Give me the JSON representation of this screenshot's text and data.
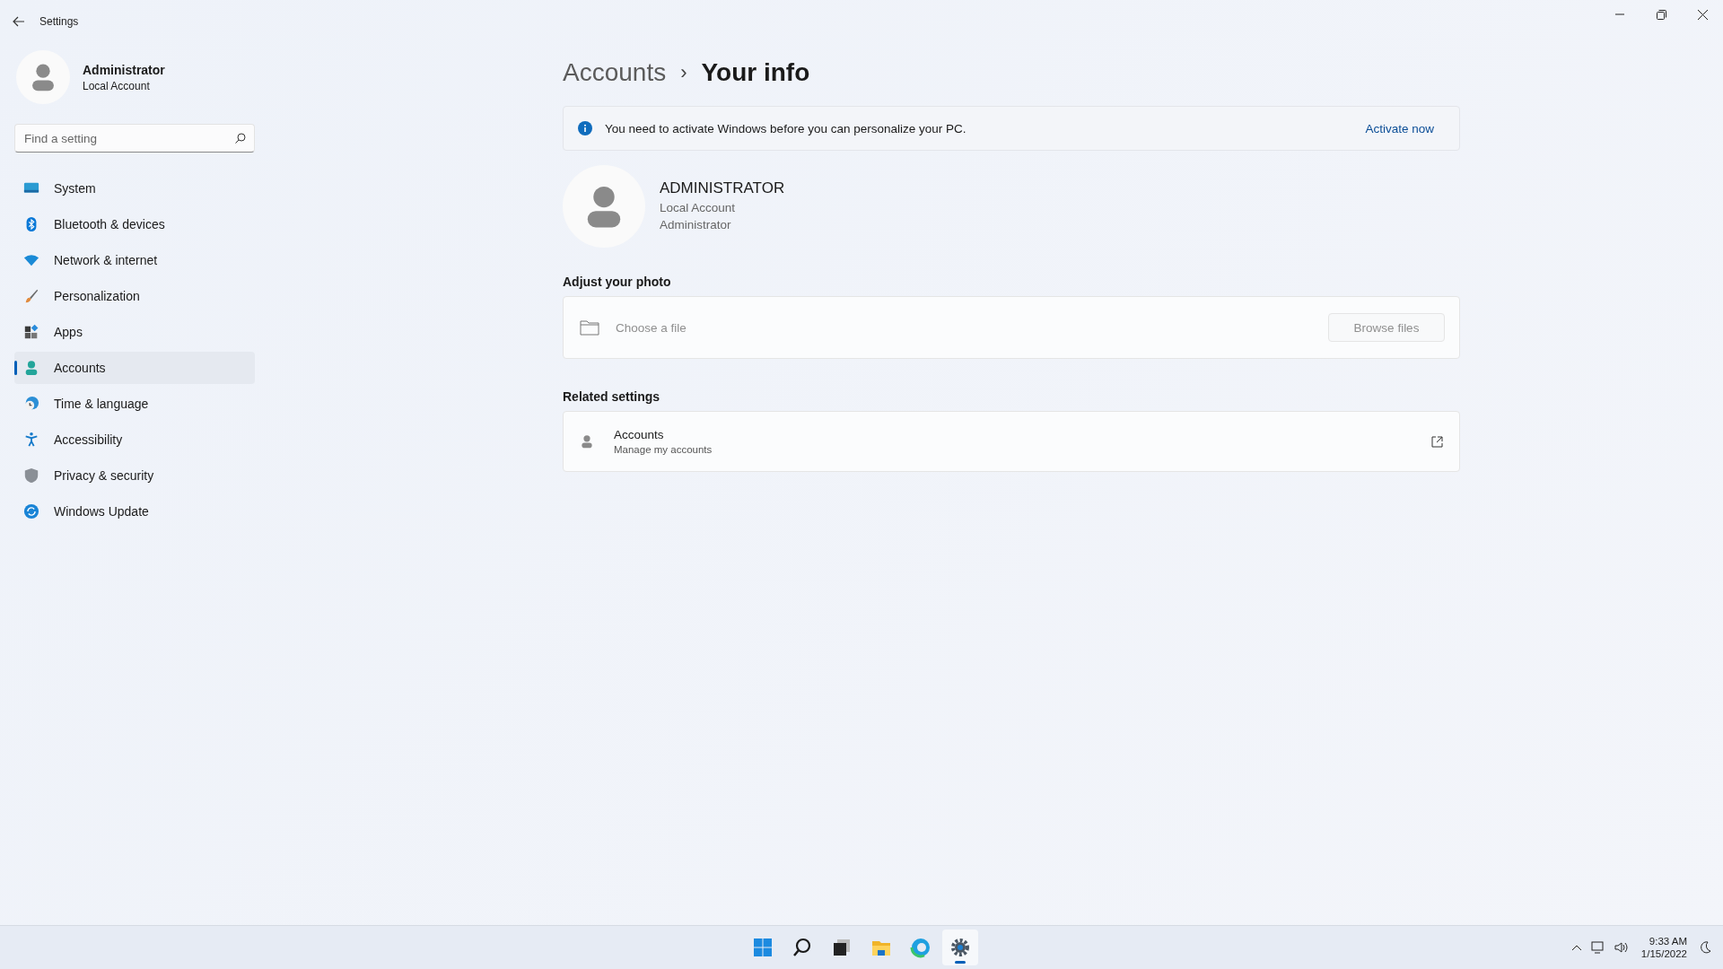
{
  "window": {
    "title": "Settings"
  },
  "profile": {
    "name": "Administrator",
    "account_type": "Local Account"
  },
  "search": {
    "placeholder": "Find a setting"
  },
  "sidebar": {
    "items": [
      {
        "label": "System",
        "selected": false
      },
      {
        "label": "Bluetooth & devices",
        "selected": false
      },
      {
        "label": "Network & internet",
        "selected": false
      },
      {
        "label": "Personalization",
        "selected": false
      },
      {
        "label": "Apps",
        "selected": false
      },
      {
        "label": "Accounts",
        "selected": true
      },
      {
        "label": "Time & language",
        "selected": false
      },
      {
        "label": "Accessibility",
        "selected": false
      },
      {
        "label": "Privacy & security",
        "selected": false
      },
      {
        "label": "Windows Update",
        "selected": false
      }
    ]
  },
  "breadcrumb": {
    "parent": "Accounts",
    "separator": "›",
    "current": "Your info"
  },
  "banner": {
    "message": "You need to activate Windows before you can personalize your PC.",
    "action": "Activate now"
  },
  "user": {
    "name": "ADMINISTRATOR",
    "account_type": "Local Account",
    "role": "Administrator"
  },
  "photo_section": {
    "heading": "Adjust your photo",
    "label": "Choose a file",
    "button": "Browse files",
    "disabled": true
  },
  "related_settings": {
    "heading": "Related settings",
    "items": [
      {
        "title": "Accounts",
        "subtitle": "Manage my accounts"
      }
    ]
  },
  "taskbar": {
    "apps": [
      {
        "selected": false
      },
      {
        "selected": false
      },
      {
        "selected": false
      },
      {
        "selected": false
      },
      {
        "selected": false
      },
      {
        "selected": true
      }
    ],
    "time": "9:33 AM",
    "date": "1/15/2022"
  }
}
